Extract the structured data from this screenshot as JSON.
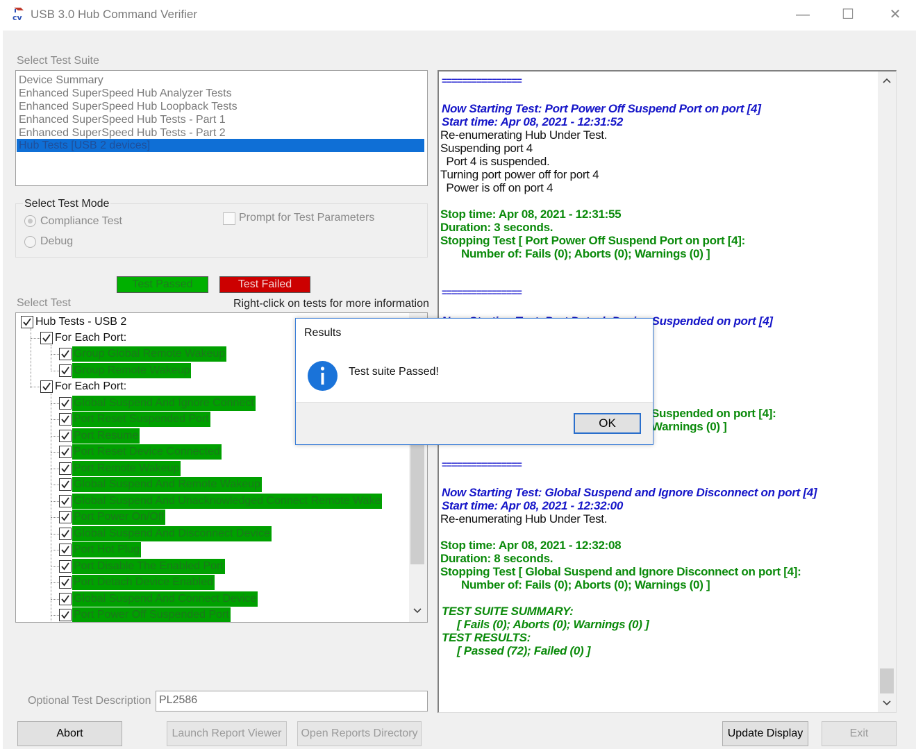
{
  "window": {
    "title": "USB 3.0 Hub Command Verifier",
    "icon": "cv-app-icon",
    "controls": {
      "minimize": "—",
      "maximize": "☐",
      "close": "✕"
    }
  },
  "suite": {
    "label": "Select Test Suite",
    "items": [
      "Device Summary",
      "Enhanced SuperSpeed Hub Analyzer Tests",
      "Enhanced SuperSpeed Hub Loopback Tests",
      "Enhanced SuperSpeed Hub Tests - Part 1",
      "Enhanced SuperSpeed Hub Tests - Part 2",
      "Hub Tests [USB 2 devices]"
    ],
    "selected_index": 5
  },
  "mode": {
    "label": "Select Test Mode",
    "compliance": "Compliance Test",
    "debug": "Debug",
    "prompt": "Prompt for Test Parameters"
  },
  "legend": {
    "passed": "Test Passed",
    "failed": "Test Failed",
    "passed_color": "#00b000",
    "failed_color": "#cc0000"
  },
  "tests": {
    "label": "Select Test",
    "hint": "Right-click on tests for more information",
    "root": "Hub Tests - USB 2",
    "group1": "For Each Port:",
    "group1_items": [
      "Group Global Remote Wakeup",
      "Group Remote Wakeup"
    ],
    "group2": "For Each Port:",
    "group2_items": [
      "Global Suspend And Ignore Connect",
      "Port Reset Suspended Port",
      "Port Resume",
      "Port Reset Device Connected",
      "Port Remote Wakeup",
      "Global Suspend And Remote Wakeup",
      "Global Suspend And Unacknowledged Connect Remote Wake",
      "Port Power On/Off",
      "Global Suspend And Disconnect Device",
      "Port Hot Plug",
      "Port Disable The Enabled Port",
      "Port Detach Device Enabled",
      "Global Suspend And Connect Device",
      "Port Power Off Suspended Port"
    ]
  },
  "description": {
    "label": "Optional Test Description",
    "value": "PL2586"
  },
  "buttons": {
    "abort": "Abort",
    "launch": "Launch Report Viewer",
    "open_reports": "Open Reports Directory",
    "update": "Update Display",
    "exit": "Exit"
  },
  "log": {
    "separator": "================",
    "block1": {
      "start": "Now Starting Test: Port Power Off Suspend Port on port [4]",
      "start_time": "Start time: Apr 08, 2021 - 12:31:52",
      "lines": [
        "Re-enumerating Hub Under Test.",
        "Suspending port 4",
        " Port 4 is suspended.",
        "Turning port power off for port 4",
        " Power is off on port 4"
      ],
      "stop_time": "Stop time: Apr 08, 2021 - 12:31:55",
      "duration": "Duration:  3 seconds.",
      "stopping": "Stopping Test [ Port Power Off Suspend Port on port [4]:",
      "counts": "Number of: Fails (0); Aborts (0); Warnings (0) ]"
    },
    "block2": {
      "start_tail": "Now Starting Test: Port Detach Device Suspended on port [4]",
      "stop_tail": "Suspended on port [4]:",
      "counts_tail": "Warnings (0) ]"
    },
    "block3": {
      "start": "Now Starting Test: Global Suspend and Ignore Disconnect on port [4]",
      "start_time": "Start time: Apr 08, 2021 - 12:32:00",
      "lines": [
        "Re-enumerating Hub Under Test."
      ],
      "stop_time": "Stop time: Apr 08, 2021 - 12:32:08",
      "duration": "Duration:  8 seconds.",
      "stopping": "Stopping Test [ Global Suspend and Ignore Disconnect on port [4]:",
      "counts": "Number of: Fails (0); Aborts (0); Warnings (0) ]"
    },
    "summary": {
      "title": "TEST SUITE SUMMARY:",
      "line": "[ Fails (0); Aborts (0); Warnings (0) ]",
      "results_title": "TEST RESULTS:",
      "results": "[ Passed (72); Failed (0) ]"
    }
  },
  "dialog": {
    "title": "Results",
    "message": "Test suite Passed!",
    "ok": "OK",
    "icon": "info-icon"
  }
}
